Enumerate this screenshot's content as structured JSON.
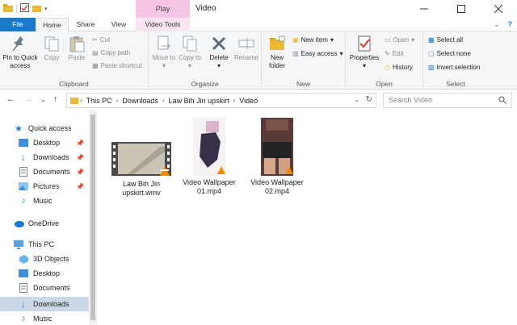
{
  "window": {
    "title": "Video",
    "context_tab_group": "Play"
  },
  "tabs": {
    "file": "File",
    "home": "Home",
    "share": "Share",
    "view": "View",
    "video_tools": "Video Tools"
  },
  "ribbon": {
    "clipboard": {
      "label": "Clipboard",
      "pin_to_quick_access": "Pin to Quick access",
      "copy": "Copy",
      "paste": "Paste",
      "cut": "Cut",
      "copy_path": "Copy path",
      "paste_shortcut": "Paste shortcut"
    },
    "organize": {
      "label": "Organize",
      "move_to": "Move to",
      "copy_to": "Copy to",
      "delete": "Delete",
      "rename": "Rename"
    },
    "new": {
      "label": "New",
      "new_folder": "New folder",
      "new_item": "New item",
      "easy_access": "Easy access"
    },
    "open": {
      "label": "Open",
      "properties": "Properties",
      "open": "Open",
      "edit": "Edit",
      "history": "History"
    },
    "select": {
      "label": "Select",
      "select_all": "Select all",
      "select_none": "Select none",
      "invert_selection": "Invert selection"
    }
  },
  "address": {
    "crumbs": [
      "This PC",
      "Downloads",
      "Law Bih Jin upskirt",
      "Video"
    ]
  },
  "search": {
    "placeholder": "Search Video"
  },
  "nav": {
    "quick_access": "Quick access",
    "qa_items": [
      "Desktop",
      "Downloads",
      "Documents",
      "Pictures",
      "Music"
    ],
    "onedrive": "OneDrive",
    "this_pc": "This PC",
    "pc_items": [
      "3D Objects",
      "Desktop",
      "Documents",
      "Downloads",
      "Music"
    ]
  },
  "files": [
    {
      "name_line1": "Law Bih Jin",
      "name_line2": "upskirt.wmv"
    },
    {
      "name_line1": "Video Wallpaper",
      "name_line2": "01.mp4"
    },
    {
      "name_line1": "Video Wallpaper",
      "name_line2": "02.mp4"
    }
  ],
  "colors": {
    "accent": "#1979ca",
    "context_tab": "#f6c6e4",
    "nav_selected": "#ccd8e6",
    "folder": "#e8b838"
  }
}
